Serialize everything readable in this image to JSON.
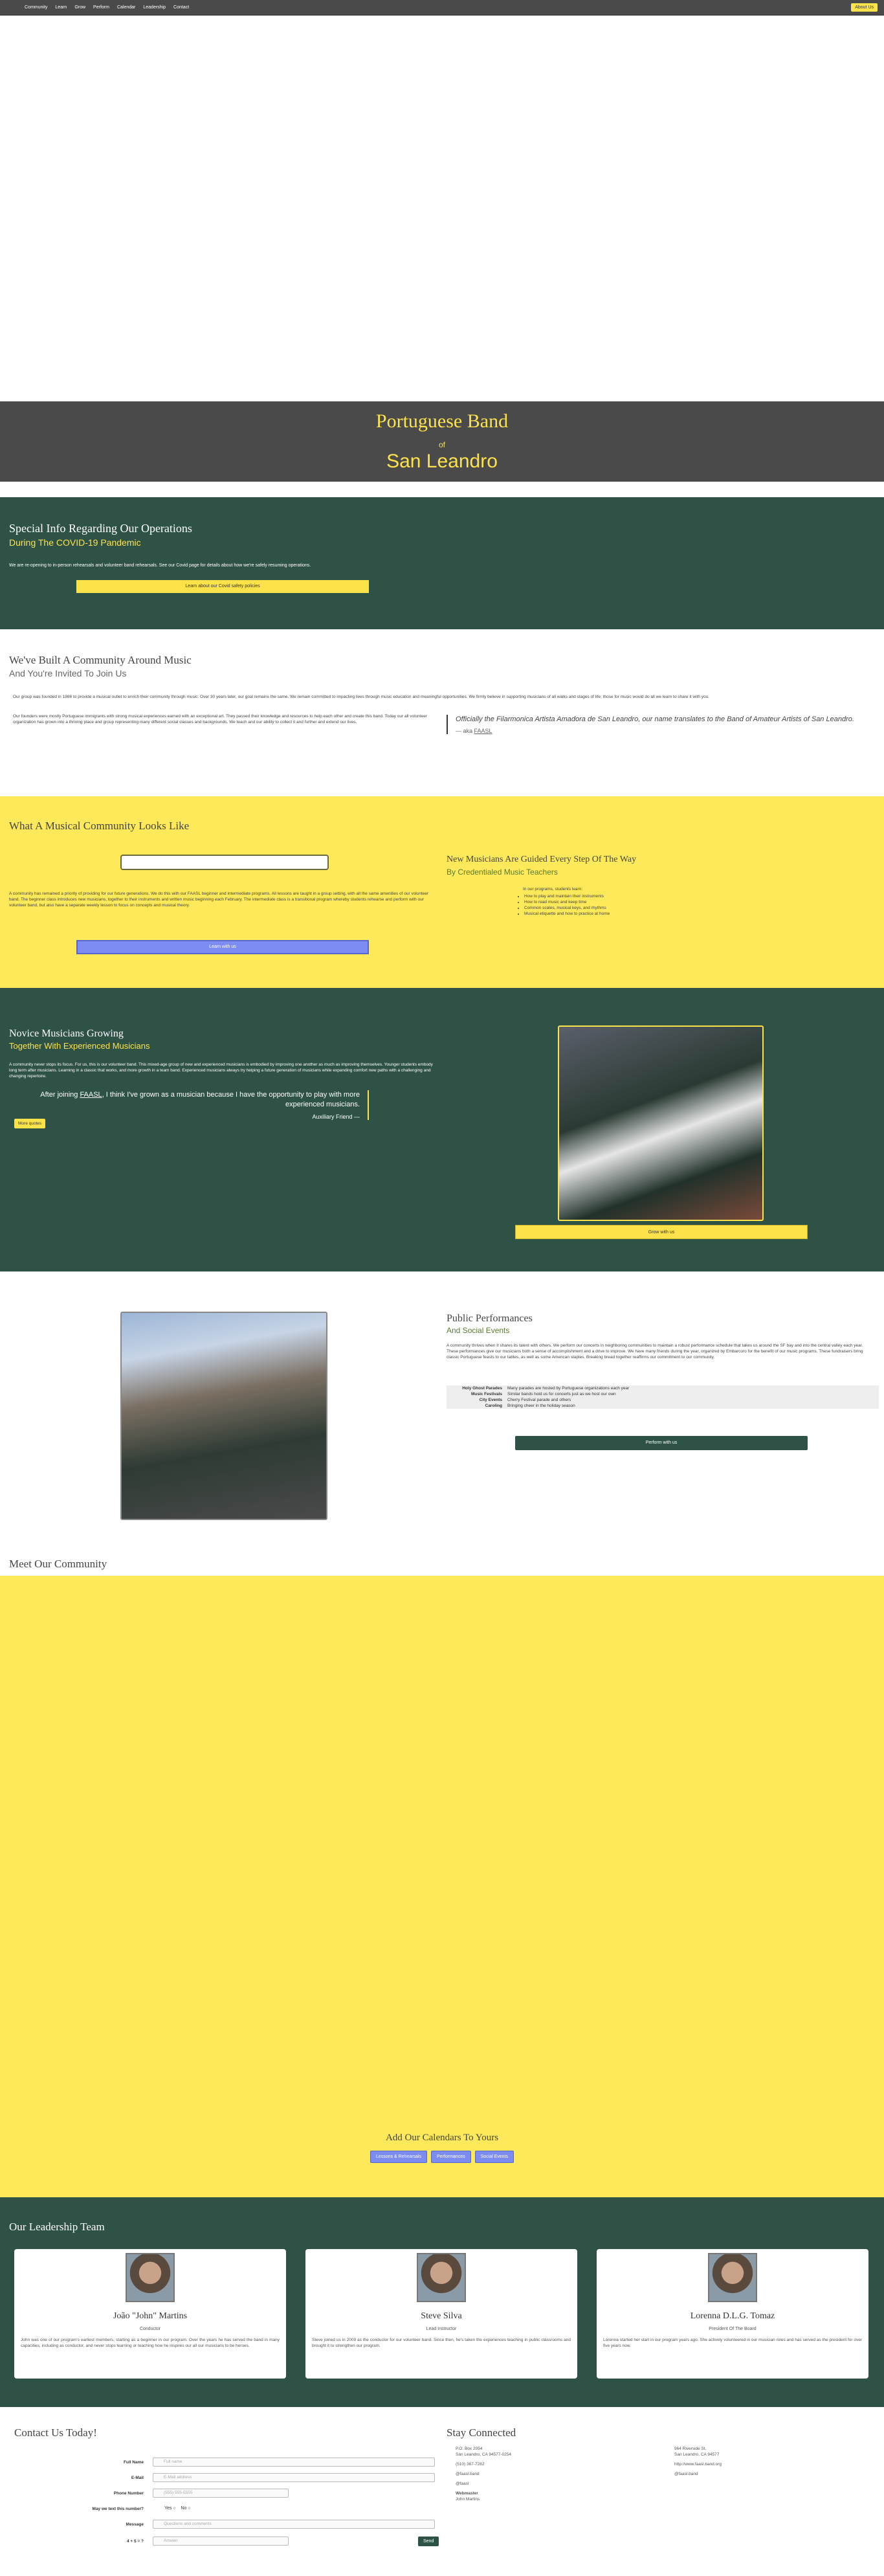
{
  "nav": {
    "items": [
      "Community",
      "Learn",
      "Grow",
      "Perform",
      "Calendar",
      "Leadership",
      "Contact"
    ],
    "about_button": "About Us"
  },
  "banner": {
    "title": "Portuguese Band",
    "of": "of",
    "city": "San Leandro"
  },
  "covid": {
    "title": "Special Info Regarding Our Operations",
    "subtitle": "During The COVID-19 Pandemic",
    "text": "We are re-opening to in-person rehearsals and volunteer band rehearsals. See our Covid page for details about how we're safely resuming operations.",
    "button": "Learn about our Covid safety policies"
  },
  "community": {
    "title": "We've Built A Community Around Music",
    "subtitle": "And You're Invited To Join Us",
    "paragraph1": "Our group was founded in 1986 to provide a musical outlet to enrich their community through music. Over 30 years later, our goal remains the same. We remain committed to impacting lives through music education and meaningful opportunities. We firmly believe in supporting musicians of all walks and stages of life; those for music would do all we learn to share it with you.",
    "paragraph2": "Our founders were mostly Portuguese immigrants with strong musical experiences earned with an exceptional art. They passed their knowledge and resources to help each other and create this band. Today our all volunteer organization has grown into a thriving place and group representing many different social classes and backgrounds. We teach and our ability to collect it and further and extend our lives.",
    "quote": "Officially the Filarmonica Artista Amadora de San Leandro, our name translates to the Band of Amateur Artists of San Leandro.",
    "cite_prefix": "— aka",
    "cite_link": "FAASL"
  },
  "looks": {
    "title": "What A Musical Community Looks Like",
    "paragraph": "A community has remained a priority of providing for our future generations. We do this with our FAASL beginner and intermediate programs. All lessons are taught in a group setting, with all the same amenities of our volunteer band. The beginner class introduces new musicians, together to their instruments and written music beginning each February. The intermediate class is a transitional program whereby students rehearse and perform with our volunteer band, but also have a separate weekly lesson to focus on concepts and musical theory.",
    "button": "Learn with us",
    "right_title": "New Musicians Are Guided Every Step Of The Way",
    "right_subtitle": "By Credentialed Music Teachers",
    "list_intro": "In our programs, students learn:",
    "list": [
      "How to play and maintain their instruments",
      "How to read music and keep time",
      "Common scales, musical keys, and rhythms",
      "Musical etiquette and how to practice at home"
    ]
  },
  "novice": {
    "title": "Novice Musicians Growing",
    "subtitle": "Together With Experienced Musicians",
    "paragraph": "A community never stops its focus. For us, this is our volunteer band. This mixed-age group of new and experienced musicians is embodied by improving one another as much as improving themselves. Younger students embody long term after musicians. Learning in a classic that works, and more growth in a team band. Experienced musicians always try helping a future generation of musicians while expanding comfort new paths with a challenging and changing repertoire.",
    "quote_prefix": "After joining",
    "quote_link": "FAASL",
    "quote_rest": ", I think I've grown as a musician because I have the opportunity to play with more experienced musicians.",
    "cite": "Auxiliary Friend —",
    "pill": "More quotes",
    "button": "Grow with us"
  },
  "public": {
    "title": "Public Performances",
    "subtitle": "And Social Events",
    "paragraph": "A community thrives when it shares its talent with others. We perform our concerts in neighboring communities to maintain a robust performance schedule that takes us around the SF bay and into the central valley each year. These performances give our musicians both a sense of accomplishment and a drive to improve. We have many friends during the year, organized by Embarcoro for the benefit of our music programs. These fundraisers bring classic Portuguese feasts to our tables, as well as some American staples. Breaking bread together reaffirms our commitment to our community.",
    "rows": [
      {
        "k": "Holy Ghost Parades",
        "v": "Many parades are hosted by Portuguese organizations each year"
      },
      {
        "k": "Music Festivals",
        "v": "Similar bands hold us for concerts just as we host our own"
      },
      {
        "k": "City Events",
        "v": "Cherry Festival parade and others"
      },
      {
        "k": "Caroling",
        "v": "Bringing cheer in the holiday season"
      }
    ],
    "button": "Perform with us"
  },
  "meet": {
    "title": "Meet Our Community",
    "calendar_title": "Add Our Calendars To Yours",
    "calendar_buttons": [
      "Lessons & Rehearsals",
      "Performances",
      "Social Events"
    ]
  },
  "leadership": {
    "title": "Our Leadership Team",
    "people": [
      {
        "name": "João \"John\" Martins",
        "role": "Conductor",
        "bio": "John was one of our program's earliest members, starting as a beginner in our program. Over the years he has served the band in many capacities, including as conductor, and never stops learning or teaching how he inspires our all our musicians to be heroes."
      },
      {
        "name": "Steve Silva",
        "role": "Lead Instructor",
        "bio": "Steve joined us in 2009 as the conductor for our volunteer band. Since then, he's taken the experiences teaching in public classrooms and brought it to strengthen our program."
      },
      {
        "name": "Lorenna D.L.G. Tomaz",
        "role": "President Of The Board",
        "bio": "Lorenna started her start in our program years ago. She actively volunteered in our musician roles and has served as the president for over five years now."
      }
    ]
  },
  "contact": {
    "title": "Contact Us Today!",
    "fields": [
      {
        "label": "Full Name",
        "placeholder": "Full name"
      },
      {
        "label": "E-Mail",
        "placeholder": "E-Mail address"
      },
      {
        "label": "Phone Number",
        "placeholder": "(555) 555-5555"
      }
    ],
    "radio_label": "May we text this number?",
    "radio_yes": "Yes",
    "radio_no": "No",
    "message_label": "Message",
    "message_placeholder": "Questions and comments",
    "captcha_label": "4 + 5 = ?",
    "captcha_placeholder": "Answer",
    "send": "Send"
  },
  "stay": {
    "title": "Stay Connected",
    "col1": [
      "P.O. Box 2054",
      "San Leandro, CA 94577-0254",
      "",
      "(510) 367-7282",
      "",
      "@faasl.band",
      "",
      "@faasl",
      "",
      "Webmaster",
      "John Martins"
    ],
    "col2": [
      "964 Riverside St.",
      "San Leandro, CA 94577",
      "",
      "http://www.faasl.band.org",
      "",
      "@faasl.band"
    ]
  }
}
